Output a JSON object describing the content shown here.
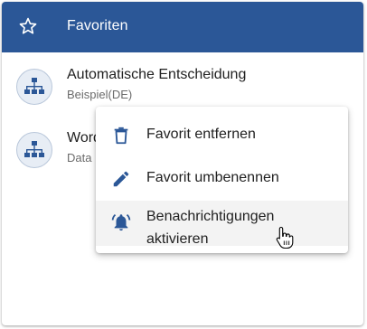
{
  "header": {
    "title": "Favoriten",
    "icon": "star-outline-icon",
    "color": "#2b5797"
  },
  "favorites": [
    {
      "name": "Automatische Entscheidung",
      "subtitle": "Beispiel(DE)",
      "icon": "org-chart-icon"
    },
    {
      "name": "Word",
      "subtitle": "Data",
      "icon": "org-chart-icon"
    }
  ],
  "context_menu": {
    "items": [
      {
        "label": "Favorit entfernen",
        "icon": "trash-icon"
      },
      {
        "label": "Favorit umbenennen",
        "icon": "pencil-icon"
      },
      {
        "label_line1": "Benachrichtigungen",
        "label_line2": "aktivieren",
        "icon": "bell-ring-icon"
      }
    ]
  }
}
